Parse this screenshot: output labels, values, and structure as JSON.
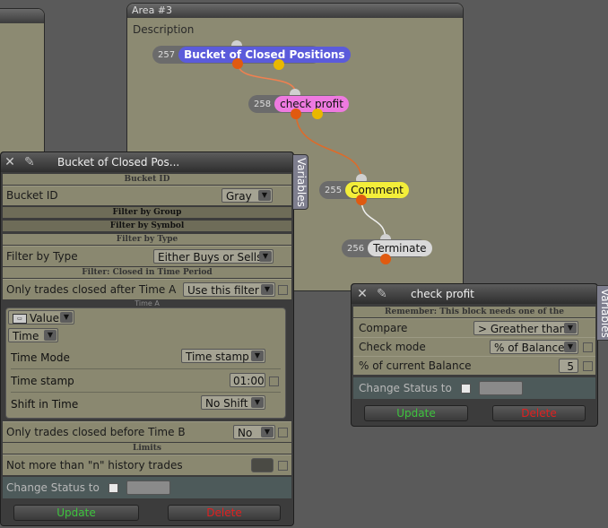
{
  "area": {
    "title": "Area #3",
    "description": "Description"
  },
  "nodes": [
    {
      "num": "257",
      "label": "Bucket of Closed Positions"
    },
    {
      "num": "258",
      "label": "check profit"
    },
    {
      "num": "255",
      "label": "Comment"
    },
    {
      "num": "256",
      "label": "Terminate"
    }
  ],
  "colors": {
    "node257": "#5b5bdb",
    "node258": "#ee7ae0",
    "node255": "#f3ee3a",
    "node256": "#d9d9d9",
    "wire": "#e06a28",
    "dot_top": "#cfcfcf",
    "dot_bottom": "#e05a10",
    "dot_yellow": "#e8b800"
  },
  "panel1": {
    "title": "Bucket of Closed Pos...",
    "variables_tab": "Variables",
    "sec_bucket": "Bucket ID",
    "bucket_label": "Bucket ID",
    "bucket_value": "Gray",
    "sec_group": "Filter by Group",
    "sec_symbol": "Filter by Symbol",
    "sec_type": "Filter by Type",
    "type_label": "Filter by Type",
    "type_value": "Either Buys or Sells",
    "sec_time": "Filter: Closed in Time Period",
    "after_label": "Only trades closed after Time A",
    "after_value": "Use this filter",
    "time_a_label": "Time A",
    "value_combo": "Value",
    "time_combo": "Time",
    "mode_label": "Time Mode",
    "mode_value": "Time stamp",
    "stamp_label": "Time stamp",
    "stamp_value": "01:00",
    "shift_label": "Shift in Time",
    "shift_value": "No Shift",
    "before_label": "Only trades closed before Time B",
    "before_value": "No",
    "sec_limits": "Limits",
    "limit_label": "Not more than \"n\" history trades",
    "status_label": "Change Status to",
    "update": "Update",
    "delete": "Delete"
  },
  "panel2": {
    "title": "check profit",
    "variables_tab": "Variables",
    "remember": "Remember: This block needs one of the",
    "compare_label": "Compare",
    "compare_value": "> Greather than",
    "mode_label": "Check mode",
    "mode_value": "% of Balance",
    "pct_label": "% of current Balance",
    "pct_value": "5",
    "status_label": "Change Status to",
    "update": "Update",
    "delete": "Delete"
  }
}
